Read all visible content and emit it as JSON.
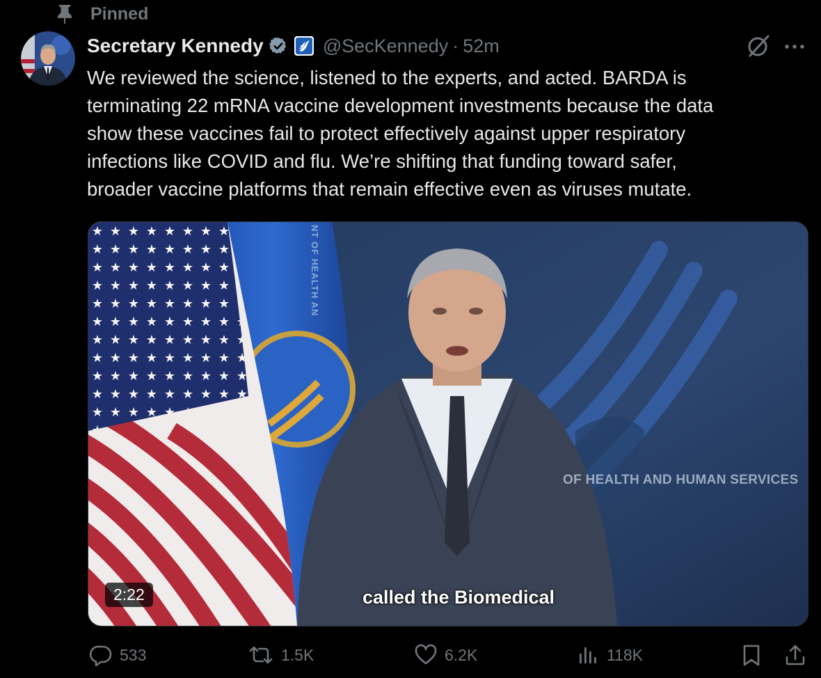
{
  "pinned": {
    "label": "Pinned"
  },
  "author": {
    "display_name": "Secretary Kennedy",
    "handle": "@SecKennedy",
    "separator": "·",
    "time_ago": "52m"
  },
  "tweet": {
    "text": "We reviewed the science, listened to the experts, and acted. BARDA is\nterminating 22 mRNA vaccine development investments because the data\nshow these vaccines fail to protect effectively against upper respiratory\ninfections like COVID and flu. We’re shifting that funding toward safer,\nbroader vaccine platforms that remain effective even as viruses mutate."
  },
  "media": {
    "duration": "2:22",
    "caption": "called the Biomedical",
    "backdrop_text": "OF HEALTH AND HUMAN SERVICES",
    "flag_text": "NT OF HEALTH AN"
  },
  "actions": {
    "replies": "533",
    "reposts": "1.5K",
    "likes": "6.2K",
    "views": "118K"
  },
  "colors": {
    "background": "#000000",
    "text_primary": "#e7e9ea",
    "text_secondary": "#71767b",
    "verified_badge": "#829aab"
  }
}
